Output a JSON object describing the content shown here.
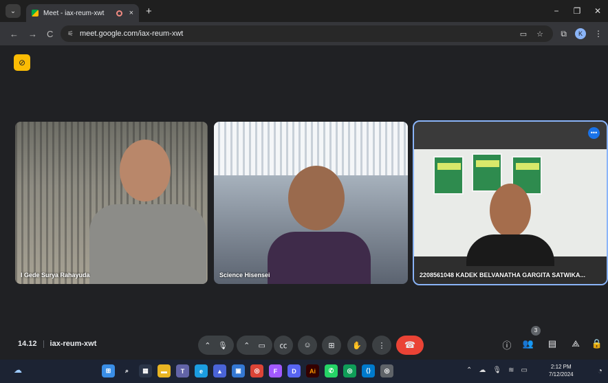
{
  "browser": {
    "tab_title": "Meet - iax-reum-xwt",
    "tab_close": "×",
    "new_tab": "+",
    "url": "meet.google.com/iax-reum-xwt",
    "profile_initial": "K",
    "window_controls": [
      "−",
      "❐",
      "✕"
    ],
    "nav_icons": [
      "←",
      "→",
      "C"
    ]
  },
  "meet": {
    "participants": [
      {
        "name": "I Gede Surya Rahayuda",
        "speaking": false
      },
      {
        "name": "Science Hisensei",
        "speaking": false
      },
      {
        "name": "2208561048 KADEK BELVANATHA GARGITA SATWIKA...",
        "speaking": true
      }
    ],
    "time": "14.12",
    "meeting_code": "iax-reum-xwt",
    "people_count": "3",
    "accent_color": "#8ab4f8",
    "end_call_color": "#ea4335"
  },
  "taskbar": {
    "time": "2:12 PM",
    "date": "7/12/2024",
    "app_icons": [
      "windows-icon",
      "search-icon",
      "taskview-icon",
      "file-explorer-icon",
      "teams-icon",
      "edge-icon",
      "photos-icon",
      "store-icon",
      "chrome-icon",
      "figma-icon",
      "discord-icon",
      "illustrator-icon",
      "whatsapp-icon",
      "chrome-active-icon",
      "vscode-icon",
      "chrome-dev-icon"
    ]
  }
}
